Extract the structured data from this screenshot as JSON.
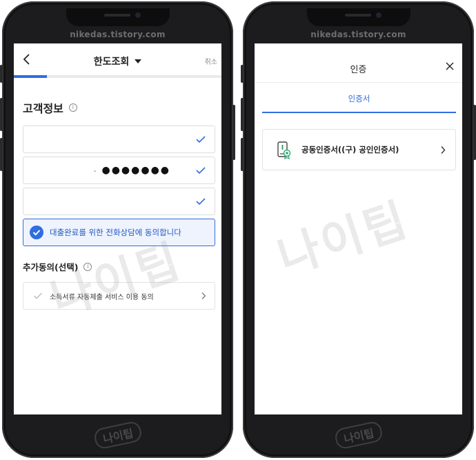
{
  "watermark": {
    "site": "nikedas.tistory.com",
    "logo": "나이팁"
  },
  "left": {
    "nav": {
      "back_icon": "chevron-left-icon",
      "title": "한도조회",
      "cancel": "취소",
      "progress": 0.16
    },
    "customer_section": {
      "title": "고객정보",
      "info_icon": "info-icon"
    },
    "fields": [
      {
        "value": "",
        "verified": true
      },
      {
        "value_prefix": "-",
        "value": "●●●●●●●",
        "verified": true
      },
      {
        "value": "",
        "verified": true
      }
    ],
    "consent": {
      "label": "대출완료를 위한 전화상담에 동의합니다",
      "checked": true
    },
    "additional": {
      "title": "추가동의(선택)",
      "items": [
        {
          "label": "소득서류 자동제출 서비스 이용 동의",
          "checked": false
        }
      ]
    }
  },
  "right": {
    "header": {
      "title": "인증",
      "close_icon": "close-icon"
    },
    "tabs": [
      {
        "label": "인증서",
        "active": true
      }
    ],
    "items": [
      {
        "label": "공동인증서((구) 공인인증서)",
        "icon": "certificate-icon"
      }
    ]
  },
  "colors": {
    "accent": "#2f6de1",
    "consent_bg": "#eef3fd",
    "phone_body": "#1c1c1e"
  }
}
